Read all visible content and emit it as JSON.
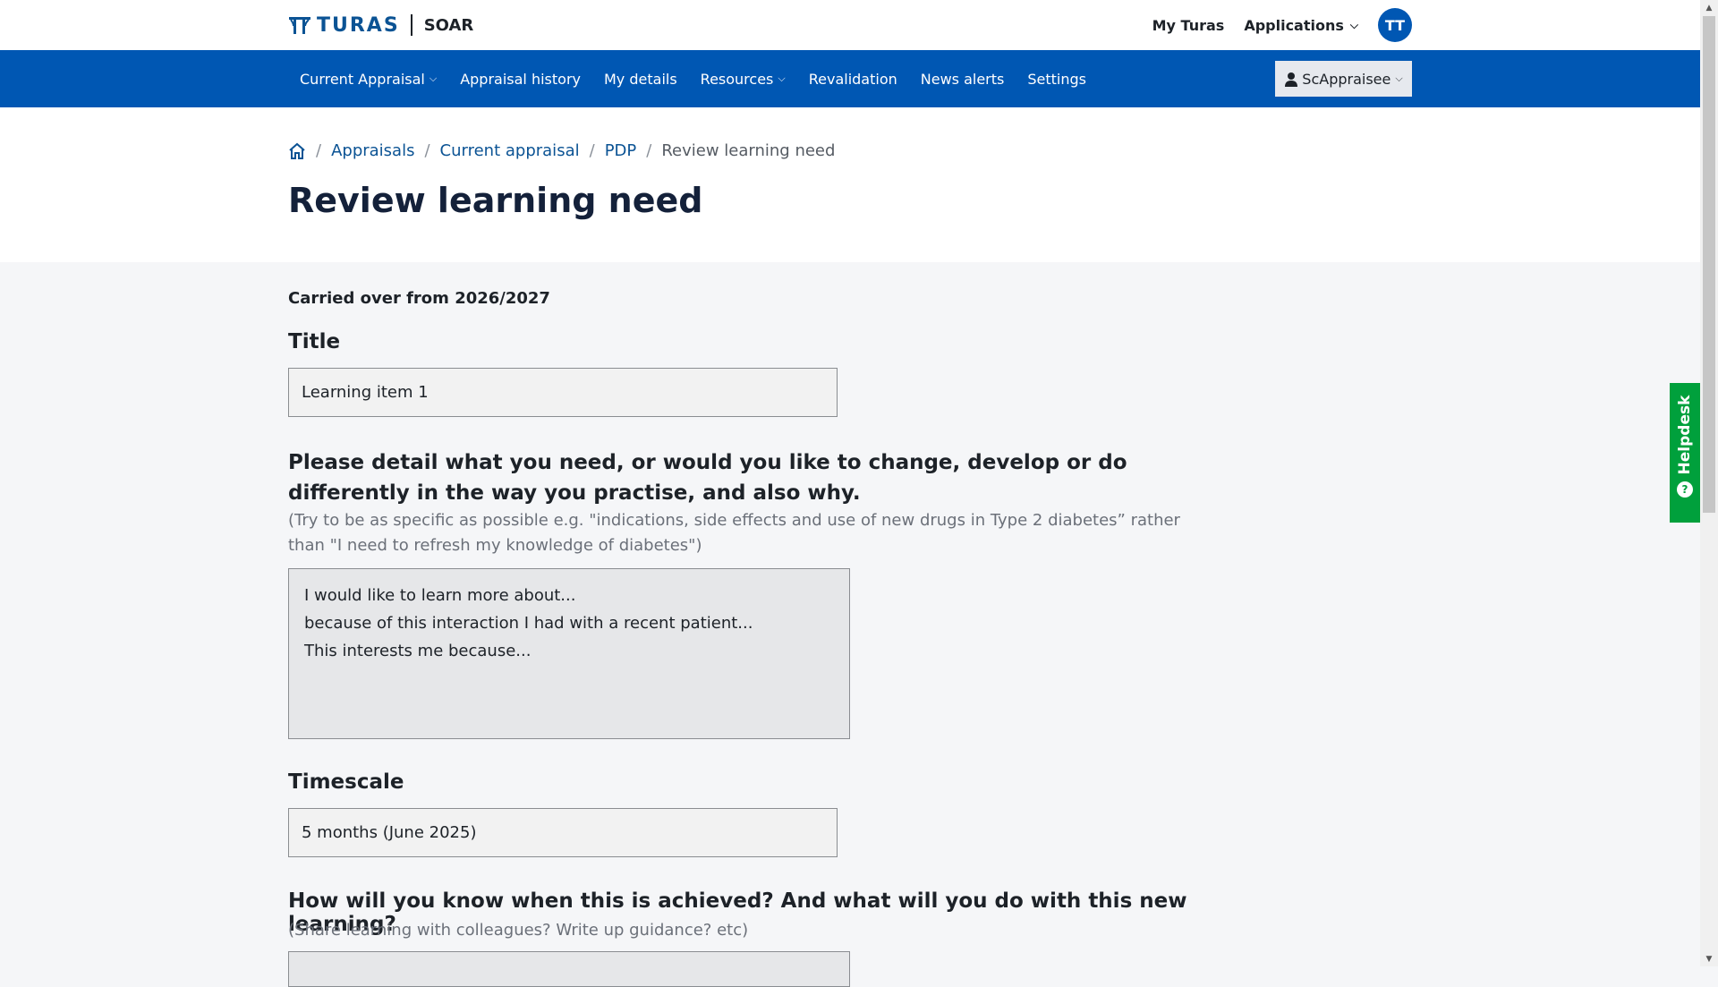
{
  "header": {
    "brand_name": "TURAS",
    "app_name": "SOAR",
    "my_turas": "My Turas",
    "applications": "Applications",
    "avatar_initials": "TT"
  },
  "nav": {
    "items": [
      {
        "label": "Current Appraisal",
        "dropdown": true
      },
      {
        "label": "Appraisal history",
        "dropdown": false
      },
      {
        "label": "My details",
        "dropdown": false
      },
      {
        "label": "Resources",
        "dropdown": true
      },
      {
        "label": "Revalidation",
        "dropdown": false
      },
      {
        "label": "News alerts",
        "dropdown": false
      },
      {
        "label": "Settings",
        "dropdown": false
      }
    ],
    "user_menu": "ScAppraisee"
  },
  "breadcrumb": {
    "items": [
      "Appraisals",
      "Current appraisal",
      "PDP"
    ],
    "current": "Review learning need"
  },
  "page_title": "Review learning need",
  "form": {
    "carried_over": "Carried over from 2026/2027",
    "title_label": "Title",
    "title_value": "Learning item 1",
    "need_question": "Please detail what you need, or would you like to change, develop or do differently in the way you practise, and also why.",
    "need_hint": "(Try to be as specific as possible e.g. \"indications, side effects and use of new drugs in Type 2 diabetes” rather than \"I need to refresh my knowledge of diabetes\")",
    "need_lines": [
      "I would like to learn more about...",
      "because of this interaction I had with a recent patient...",
      "This interests me because..."
    ],
    "timescale_label": "Timescale",
    "timescale_value": "5 months (June 2025)",
    "achieved_question": "How will you know when this is achieved? And what will you do with this new learning?",
    "achieved_hint": "(Share learning with colleagues? Write up guidance? etc)"
  },
  "helpdesk": {
    "label": "Helpdesk",
    "icon": "question-icon"
  },
  "colors": {
    "brand_blue": "#0057b3",
    "helpdesk_green": "#00a03c"
  }
}
